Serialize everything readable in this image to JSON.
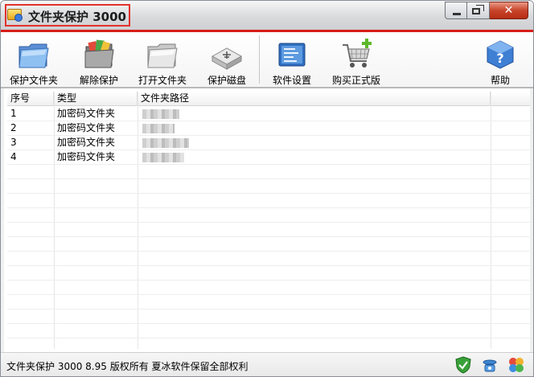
{
  "window": {
    "title": "文件夹保护 3000",
    "controls": {
      "minimize_icon": "minimize-icon",
      "maximize_icon": "restore-icon",
      "close_label": "✕"
    }
  },
  "toolbar": {
    "buttons": [
      {
        "label": "保护文件夹",
        "icon": "protect-folder-icon"
      },
      {
        "label": "解除保护",
        "icon": "unprotect-folder-icon"
      },
      {
        "label": "打开文件夹",
        "icon": "open-folder-icon"
      },
      {
        "label": "保护磁盘",
        "icon": "protect-disk-icon"
      },
      {
        "label": "软件设置",
        "icon": "settings-icon"
      },
      {
        "label": "购买正式版",
        "icon": "shopping-cart-icon"
      },
      {
        "label": "帮助",
        "icon": "help-icon"
      }
    ]
  },
  "table": {
    "columns": [
      "序号",
      "类型",
      "文件夹路径"
    ],
    "rows": [
      {
        "index": "1",
        "type": "加密码文件夹"
      },
      {
        "index": "2",
        "type": "加密码文件夹"
      },
      {
        "index": "3",
        "type": "加密码文件夹"
      },
      {
        "index": "4",
        "type": "加密码文件夹"
      }
    ]
  },
  "status": {
    "text": "文件夹保护 3000 8.95 版权所有 夏冰软件保留全部权利",
    "icons": [
      "shield-check-icon",
      "phone-icon",
      "clover-icon"
    ]
  },
  "colors": {
    "accent_red": "#d81e18",
    "title_box": "#e2322c"
  }
}
